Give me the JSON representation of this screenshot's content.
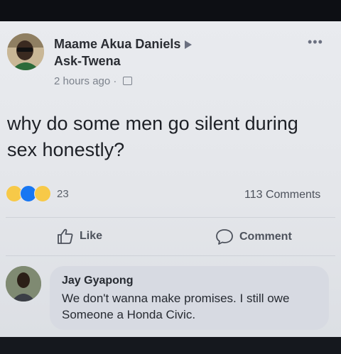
{
  "post": {
    "author": "Maame Akua Daniels",
    "group": "Ask-Twena",
    "timestamp": "2 hours ago",
    "meta_separator": "·",
    "more_icon": "more-horizontal-icon",
    "text": "why do some men go silent during sex honestly?"
  },
  "engagement": {
    "reactions": [
      "haha",
      "like",
      "wow"
    ],
    "reaction_count": "23",
    "comments_count": "113 Comments"
  },
  "actions": {
    "like_label": "Like",
    "comment_label": "Comment"
  },
  "comment": {
    "author": "Jay Gyapong",
    "text": "We don't wanna make promises. I still owe Someone a Honda Civic."
  },
  "colors": {
    "like_blue": "#1877f2",
    "reaction_yellow": "#f7c948",
    "bubble_bg": "#d7dae2"
  }
}
